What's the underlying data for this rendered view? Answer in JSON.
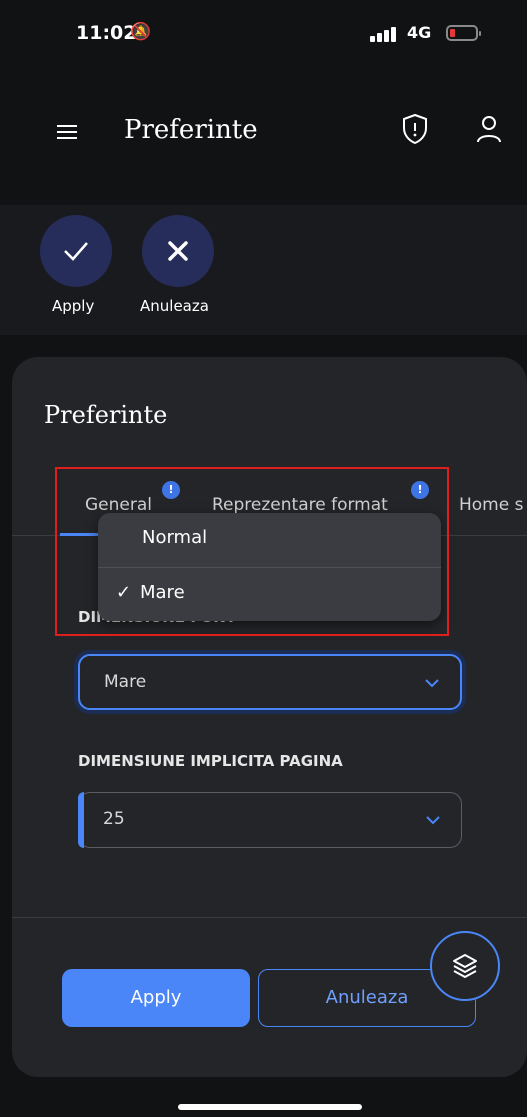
{
  "status_bar": {
    "time": "11:02",
    "network": "4G"
  },
  "header": {
    "title": "Preferinte",
    "icons": [
      "menu-icon",
      "shield-alert-icon",
      "user-icon"
    ]
  },
  "action_bar": {
    "apply_label": "Apply",
    "cancel_label": "Anuleaza"
  },
  "panel": {
    "title": "Preferinte",
    "tabs": [
      {
        "label": "General",
        "badge": "!"
      },
      {
        "label": "Reprezentare format",
        "badge": "!"
      },
      {
        "label": "Home s"
      }
    ],
    "dropdown": {
      "options": [
        "Normal",
        "Mare"
      ],
      "selected": "Mare",
      "check": "✓"
    },
    "font_size": {
      "label": "DIMENSIUNE FONT",
      "value": "Mare"
    },
    "page_size": {
      "label": "DIMENSIUNE IMPLICITA PAGINA",
      "value": "25"
    },
    "buttons": {
      "apply": "Apply",
      "cancel": "Anuleaza"
    }
  },
  "colors": {
    "accent": "#4a86f7",
    "highlight": "#e01e1e",
    "action_circle": "#262d5a"
  }
}
